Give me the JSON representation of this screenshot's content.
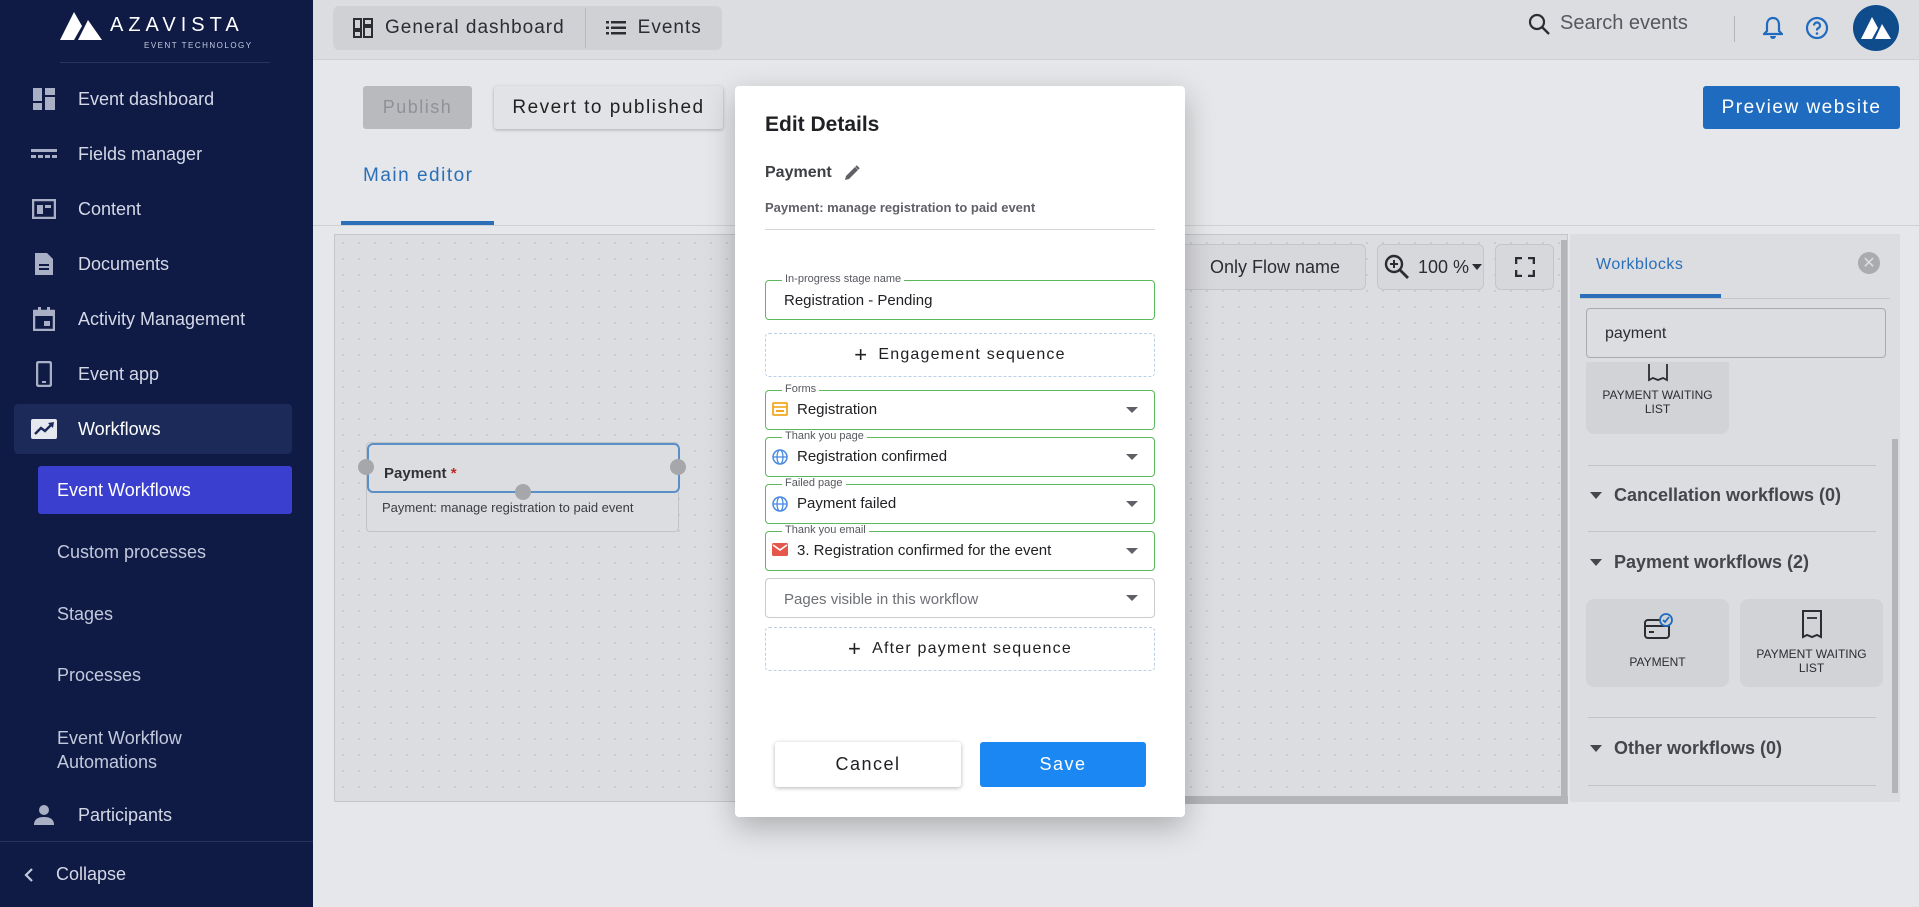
{
  "app": {
    "logo_text": "AZAVISTA",
    "logo_sub": "EVENT TECHNOLOGY"
  },
  "sidebar": {
    "items": [
      {
        "label": "Event dashboard",
        "icon": "dashboard-icon"
      },
      {
        "label": "Fields manager",
        "icon": "fields-icon"
      },
      {
        "label": "Content",
        "icon": "content-icon"
      },
      {
        "label": "Documents",
        "icon": "document-icon"
      },
      {
        "label": "Activity Management",
        "icon": "calendar-icon"
      },
      {
        "label": "Event app",
        "icon": "phone-icon"
      },
      {
        "label": "Workflows",
        "icon": "trending-icon"
      }
    ],
    "sub_items": [
      {
        "label": "Event Workflows"
      },
      {
        "label": "Custom processes"
      },
      {
        "label": "Stages"
      },
      {
        "label": "Processes"
      },
      {
        "label": "Event Workflow Automations"
      }
    ],
    "participants_label": "Participants",
    "collapse_label": "Collapse"
  },
  "topbar": {
    "tab_dashboard": "General dashboard",
    "tab_events": "Events",
    "search_placeholder": "Search events"
  },
  "toolbar": {
    "publish_label": "Publish",
    "revert_label": "Revert to published",
    "preview_label": "Preview website",
    "main_editor_tab": "Main editor"
  },
  "canvas": {
    "node_title": "Payment",
    "node_required": "*",
    "node_desc": "Payment: manage registration to paid event",
    "only_flow_label": "Only Flow name",
    "zoom_label": "100 %"
  },
  "workblocks": {
    "tab_label": "Workblocks",
    "search_value": "payment",
    "top_card_label": "PAYMENT WAITING LIST",
    "sections": [
      {
        "label": "Cancellation workflows (0)"
      },
      {
        "label": "Payment workflows (2)"
      },
      {
        "label": "Other workflows (0)"
      }
    ],
    "payment_cards": [
      {
        "label": "PAYMENT"
      },
      {
        "label": "PAYMENT WAITING LIST"
      }
    ]
  },
  "modal": {
    "title": "Edit Details",
    "subtitle": "Payment",
    "description": "Payment: manage registration to paid event",
    "in_progress": {
      "label": "In-progress stage name",
      "value": "Registration - Pending"
    },
    "engagement_label": "Engagement sequence",
    "forms": {
      "label": "Forms",
      "value": "Registration"
    },
    "thank_page": {
      "label": "Thank you page",
      "value": "Registration confirmed"
    },
    "failed_page": {
      "label": "Failed page",
      "value": "Payment failed"
    },
    "thank_email": {
      "label": "Thank you email",
      "value": "3. Registration confirmed for the event"
    },
    "pages_visible_placeholder": "Pages visible in this workflow",
    "after_payment_label": "After payment sequence",
    "cancel_label": "Cancel",
    "save_label": "Save"
  },
  "colors": {
    "sidebar_bg": "#0f1b45",
    "active_sub": "#3a3fd0",
    "accent": "#1b87f2",
    "field_border": "#5bb85d"
  }
}
